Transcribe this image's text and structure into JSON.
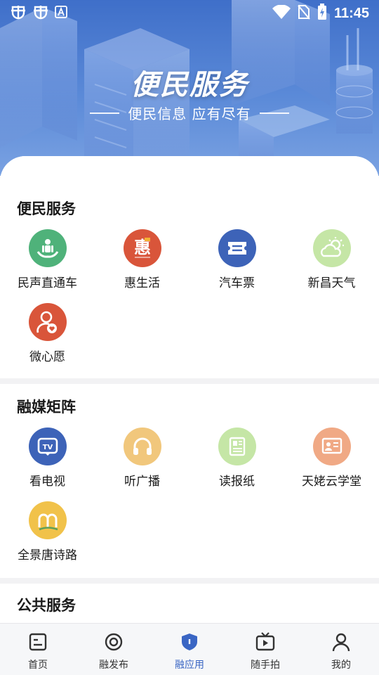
{
  "status_bar": {
    "time": "11:45",
    "left_icons": [
      "bug-icon",
      "bug-icon",
      "accessibility-a-icon"
    ],
    "right_icons": [
      "wifi-icon",
      "no-sim-icon",
      "battery-icon"
    ]
  },
  "hero": {
    "title": "便民服务",
    "subtitle": "便民信息 应有尽有"
  },
  "sections": [
    {
      "title": "便民服务",
      "items": [
        {
          "label": "民声直通车",
          "icon": "people-hands-icon",
          "color": "#4fb27a"
        },
        {
          "label": "惠生活",
          "icon": "hui-logo-icon",
          "color": "#d9553a"
        },
        {
          "label": "汽车票",
          "icon": "bus-ticket-icon",
          "color": "#3d63b8"
        },
        {
          "label": "新昌天气",
          "icon": "weather-sun-cloud-icon",
          "color": "#c5e6a6"
        },
        {
          "label": "微心愿",
          "icon": "wish-person-heart-icon",
          "color": "#d9553a"
        }
      ]
    },
    {
      "title": "融媒矩阵",
      "items": [
        {
          "label": "看电视",
          "icon": "tv-icon",
          "color": "#3d63b8"
        },
        {
          "label": "听广播",
          "icon": "headphones-icon",
          "color": "#f1c77c"
        },
        {
          "label": "读报纸",
          "icon": "newspaper-icon",
          "color": "#c5e6a6"
        },
        {
          "label": "天姥云学堂",
          "icon": "classroom-board-icon",
          "color": "#f0a985"
        },
        {
          "label": "全景唐诗路",
          "icon": "panorama-road-icon",
          "color": "#f1c24a"
        }
      ]
    },
    {
      "title": "公共服务",
      "items": []
    }
  ],
  "tabbar": [
    {
      "label": "首页",
      "icon": "home-doc-icon",
      "active": false
    },
    {
      "label": "融发布",
      "icon": "target-circle-icon",
      "active": false
    },
    {
      "label": "融应用",
      "icon": "shield-icon",
      "active": true
    },
    {
      "label": "随手拍",
      "icon": "video-play-icon",
      "active": false
    },
    {
      "label": "我的",
      "icon": "user-icon",
      "active": false
    }
  ],
  "colors": {
    "accent": "#3a66c4",
    "hero_top": "#3f6fc9",
    "hero_bottom": "#7aa2e2"
  }
}
